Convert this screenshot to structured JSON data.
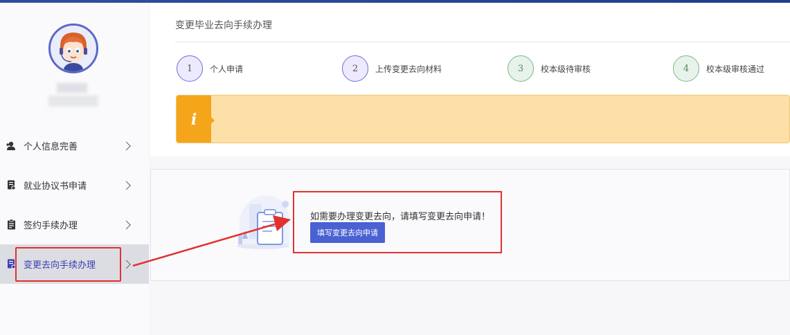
{
  "sidebar": {
    "items": [
      {
        "label": "个人信息完善",
        "icon": "user-icon",
        "active": false
      },
      {
        "label": "就业协议书申请",
        "icon": "document-icon",
        "active": false
      },
      {
        "label": "签约手续办理",
        "icon": "clipboard-icon",
        "active": false
      },
      {
        "label": "变更去向手续办理",
        "icon": "form-icon",
        "active": true
      }
    ]
  },
  "main": {
    "title": "变更毕业去向手续办理",
    "steps": [
      {
        "number": "1",
        "label": "个人申请",
        "state": "current"
      },
      {
        "number": "2",
        "label": "上传变更去向材料",
        "state": "current"
      },
      {
        "number": "3",
        "label": "校本级待审核",
        "state": "pending"
      },
      {
        "number": "4",
        "label": "校本级审核通过",
        "state": "pending"
      }
    ],
    "notice_icon": "i",
    "notice_text": "",
    "prompt_text": "如需要办理变更去向，请填写变更去向申请！",
    "fill_button": "填写变更去向申请"
  },
  "colors": {
    "accent": "#4a61d2",
    "highlight_border": "#e23030",
    "notice_bg": "#fce0a8",
    "notice_icon_bg": "#f5a51a",
    "step_blue": "#6a6fd6",
    "step_green": "#7fb48c"
  }
}
